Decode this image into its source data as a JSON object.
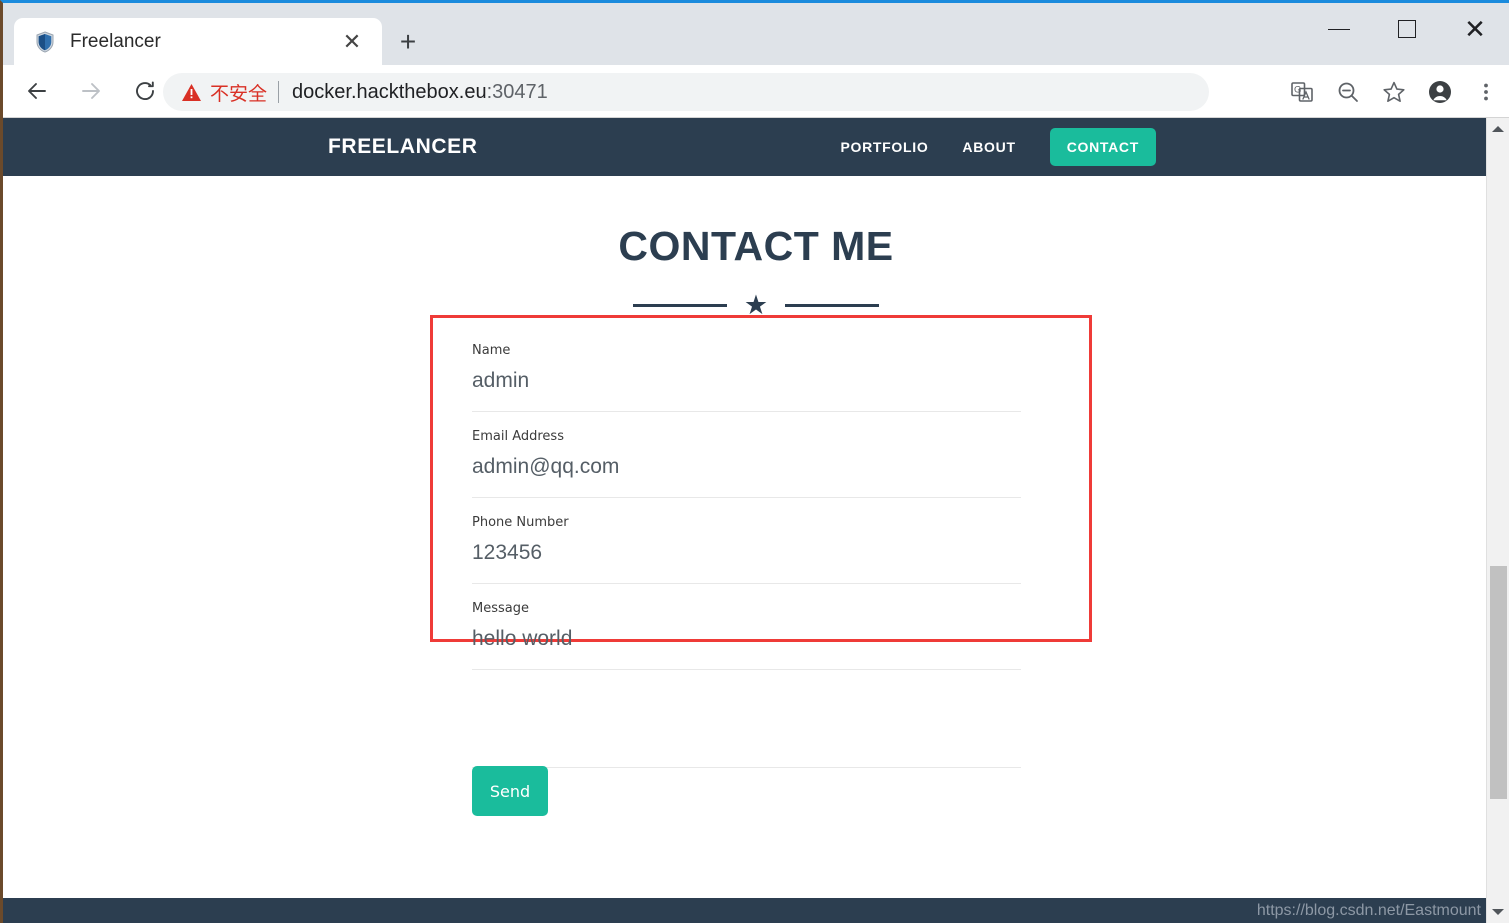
{
  "browser": {
    "tab": {
      "title": "Freelancer",
      "favicon": "shield-icon",
      "close_label": "✕"
    },
    "new_tab_label": "+",
    "window_controls": {
      "minimize": "minimize-icon",
      "maximize": "maximize-icon",
      "close": "✕"
    },
    "toolbar": {
      "back": "back-arrow-icon",
      "forward": "forward-arrow-icon",
      "reload": "reload-icon",
      "security_warning": "不安全",
      "url_host": "docker.hackthebox.eu",
      "url_port": ":30471",
      "icons": [
        "translate-icon",
        "zoom-out-icon",
        "bookmark-star-icon",
        "profile-avatar-icon",
        "menu-kebab-icon"
      ]
    }
  },
  "page": {
    "navbar": {
      "brand": "FREELANCER",
      "links": [
        {
          "label": "PORTFOLIO",
          "active": false
        },
        {
          "label": "ABOUT",
          "active": false
        },
        {
          "label": "CONTACT",
          "active": true
        }
      ],
      "bg_color": "#2c3e50",
      "accent_color": "#1abc9c"
    },
    "heading": "CONTACT ME",
    "divider_star": "★",
    "form": {
      "highlight_color": "#ef3b38",
      "fields": [
        {
          "label": "Name",
          "value": "admin"
        },
        {
          "label": "Email Address",
          "value": "admin@qq.com"
        },
        {
          "label": "Phone Number",
          "value": "123456"
        },
        {
          "label": "Message",
          "value": "hello world"
        }
      ],
      "submit_label": "Send"
    },
    "footer": {
      "watermark": "https://blog.csdn.net/Eastmount"
    }
  },
  "scrollbar": {
    "up_arrow": "scroll-up-arrow-icon",
    "down_arrow": "scroll-down-arrow-icon"
  }
}
